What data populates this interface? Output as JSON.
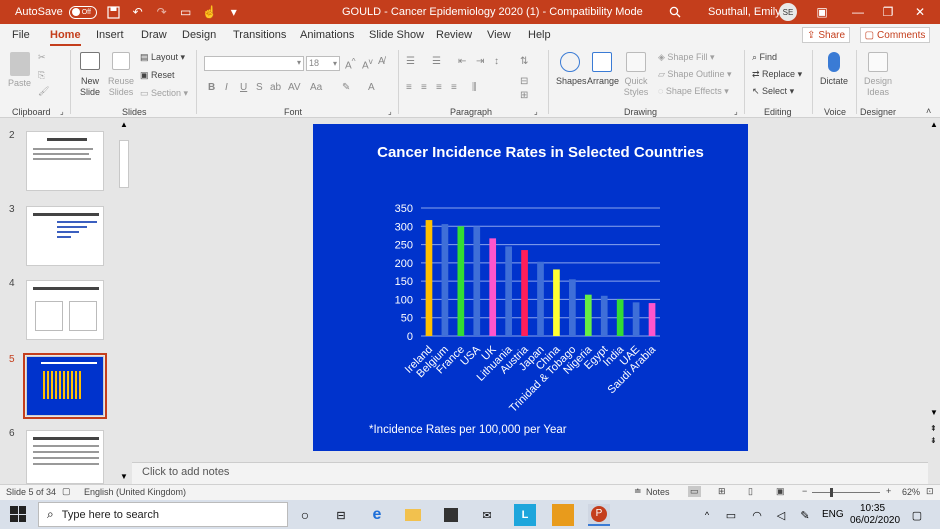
{
  "titlebar": {
    "autosave_label": "AutoSave",
    "autosave_state": "Off",
    "doc_title": "GOULD - Cancer Epidemiology 2020 (1)  -  Compatibility Mode",
    "user_name": "Southall, Emily L",
    "user_initials": "SE"
  },
  "menu": {
    "items": [
      "File",
      "Home",
      "Insert",
      "Draw",
      "Design",
      "Transitions",
      "Animations",
      "Slide Show",
      "Review",
      "View",
      "Help"
    ],
    "active": "Home",
    "share": "Share",
    "comments": "Comments"
  },
  "ribbon": {
    "clipboard": {
      "label": "Clipboard",
      "paste": "Paste"
    },
    "slides": {
      "label": "Slides",
      "new_slide": "New Slide",
      "reuse_slides": "Reuse Slides",
      "layout": "Layout",
      "reset": "Reset",
      "section": "Section"
    },
    "font": {
      "label": "Font",
      "size": "18"
    },
    "paragraph": {
      "label": "Paragraph"
    },
    "drawing": {
      "label": "Drawing",
      "shapes": "Shapes",
      "arrange": "Arrange",
      "quick_styles": "Quick Styles",
      "shape_fill": "Shape Fill",
      "shape_outline": "Shape Outline",
      "shape_effects": "Shape Effects"
    },
    "editing": {
      "label": "Editing",
      "find": "Find",
      "replace": "Replace",
      "select": "Select"
    },
    "voice": {
      "label": "Voice",
      "dictate": "Dictate"
    },
    "designer": {
      "label": "Designer",
      "design_ideas": "Design Ideas"
    }
  },
  "thumbnails": [
    {
      "num": "2",
      "title": "Learning Outcomes"
    },
    {
      "num": "3",
      "title": "Comparison of leading causes of death"
    },
    {
      "num": "4",
      "title": "Death rates from cancer and heart disease"
    },
    {
      "num": "5",
      "title": "Cancer Incidence Rates in Selected Countries"
    },
    {
      "num": "6",
      "title": "International geographic variation in cancer incidence"
    }
  ],
  "slide": {
    "footnote": "*Incidence Rates per 100,000 per Year"
  },
  "chart_data": {
    "type": "bar",
    "title": "Cancer Incidence Rates in Selected Countries",
    "categories": [
      "Ireland",
      "Belgium",
      "France",
      "USA",
      "UK",
      "Lithuania",
      "Austria",
      "Japan",
      "China",
      "Trinidad & Tobago",
      "Nigeria",
      "Egypt",
      "India",
      "UAE",
      "Saudi Arabia"
    ],
    "values": [
      317,
      306,
      300,
      300,
      267,
      245,
      235,
      203,
      182,
      155,
      113,
      110,
      100,
      92,
      90
    ],
    "colors": [
      "#ffc000",
      "#3f6fd8",
      "#33dd33",
      "#3f6fd8",
      "#ff55cc",
      "#3f6fd8",
      "#ff1f5a",
      "#3f6fd8",
      "#ffff33",
      "#3f6fd8",
      "#66ee44",
      "#3f6fd8",
      "#33dd33",
      "#3f6fd8",
      "#ff55cc"
    ],
    "ylim": [
      0,
      350
    ],
    "yticks": [
      0,
      50,
      100,
      150,
      200,
      250,
      300,
      350
    ],
    "grid": true
  },
  "notes": {
    "placeholder": "Click to add notes"
  },
  "status": {
    "slide_info": "Slide 5 of 34",
    "language": "English (United Kingdom)",
    "notes": "Notes",
    "zoom": "62%"
  },
  "taskbar": {
    "search_placeholder": "Type here to search",
    "language": "ENG",
    "time": "10:35",
    "date": "06/02/2020"
  }
}
